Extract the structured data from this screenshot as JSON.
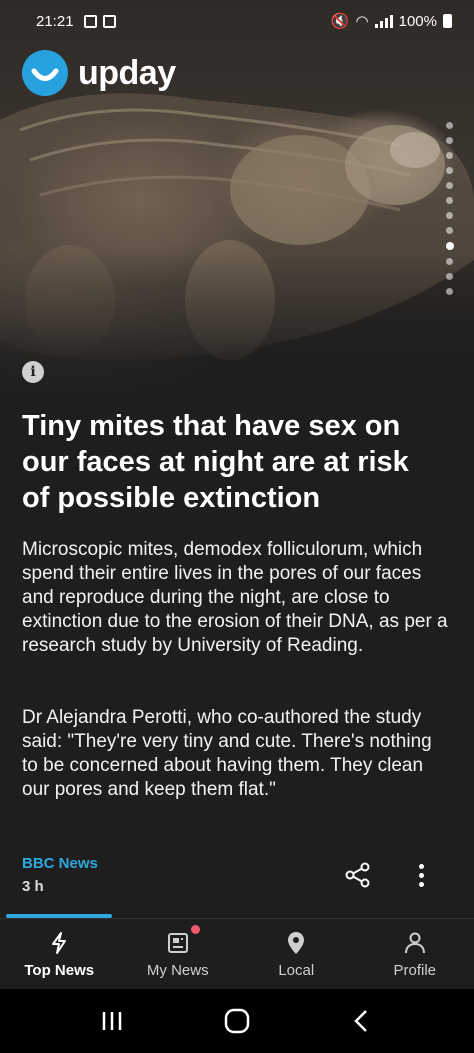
{
  "status_bar": {
    "time": "21:21",
    "battery": "100%"
  },
  "brand": {
    "name": "upday",
    "accent_color": "#27a2de"
  },
  "hero": {
    "pager_count": 12,
    "pager_active_index": 8,
    "info_icon": "info-icon"
  },
  "article": {
    "headline": "Tiny mites that have sex on our faces at night are at risk of possible extinction",
    "paragraph_1": "Microscopic mites, demodex folliculorum, which spend their entire lives in the pores of our faces and reproduce during the night, are close to extinction due to the erosion of their DNA, as per a research study by University of Reading.",
    "paragraph_2": "Dr Alejandra Perotti, who co-authored the study said: \"They're very tiny and cute. There's nothing to be concerned about having them. They clean our pores and keep them flat.\"",
    "source": "BBC News",
    "age": "3 h"
  },
  "bottom_nav": {
    "items": [
      {
        "label": "Top News",
        "icon": "lightning-icon",
        "active": true
      },
      {
        "label": "My News",
        "icon": "news-icon",
        "active": false,
        "badge": true
      },
      {
        "label": "Local",
        "icon": "location-pin-icon",
        "active": false
      },
      {
        "label": "Profile",
        "icon": "person-icon",
        "active": false
      }
    ]
  },
  "colors": {
    "accent": "#2fa8de",
    "badge": "#f05a6e",
    "background": "#1e1e1e"
  }
}
